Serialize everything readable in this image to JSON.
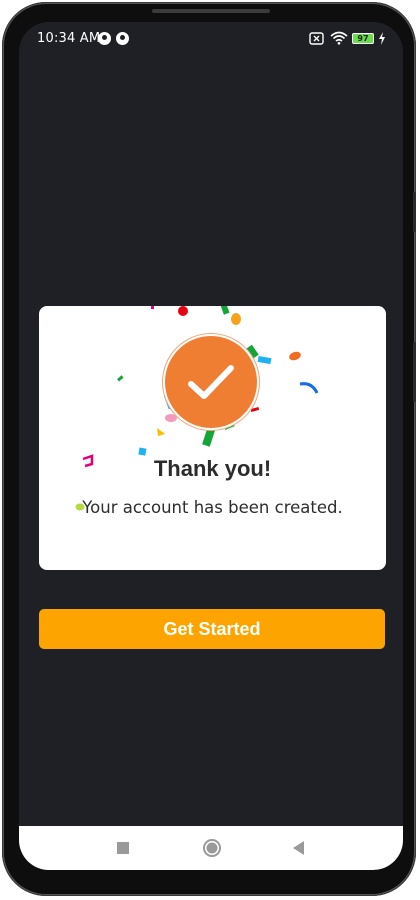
{
  "status_bar": {
    "time": "10:34 AM",
    "battery_level": "97"
  },
  "dialog": {
    "title": "Thank you!",
    "message": "Your account has been created."
  },
  "actions": {
    "get_started_label": "Get Started"
  },
  "icons": {
    "status_app_1": "app-notification-icon",
    "status_app_2": "app-notification-icon",
    "sim": "sim-icon",
    "wifi": "wifi-icon",
    "battery": "battery-icon",
    "charging": "charging-bolt-icon",
    "check": "check-icon",
    "confetti": "confetti-decoration",
    "nav_recents": "square-icon",
    "nav_home": "circle-icon",
    "nav_back": "triangle-back-icon"
  },
  "colors": {
    "screen_background": "#1f2025",
    "accent_button": "#fda400",
    "check_badge": "#ef7e33",
    "dialog_background": "#ffffff"
  }
}
